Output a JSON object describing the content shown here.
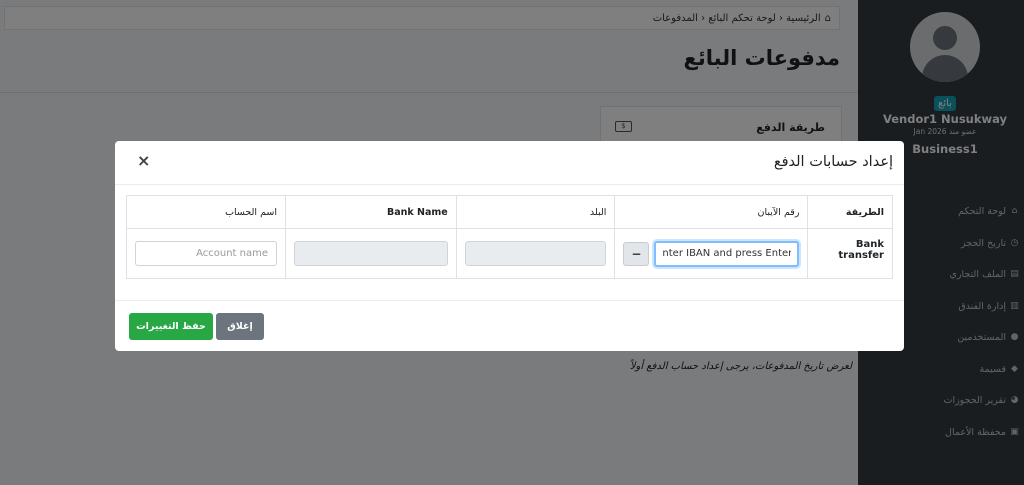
{
  "sidebar": {
    "role_badge": "بائع",
    "vendor_name": "Vendor1 Nusukway",
    "member_since": "عضو منذ Jan 2026",
    "business_name": "Business1",
    "items": [
      {
        "label": "لوحة التحكم",
        "icon": "home-icon",
        "glyph": "⌂"
      },
      {
        "label": "تاريخ الحجز",
        "icon": "clock-icon",
        "glyph": "◷"
      },
      {
        "label": "الملف التجاري",
        "icon": "briefcase-icon",
        "glyph": "▤"
      },
      {
        "label": "إدارة الفندق",
        "icon": "building-icon",
        "glyph": "▥"
      },
      {
        "label": "المستخدمين",
        "icon": "users-icon",
        "glyph": "●"
      },
      {
        "label": "قسيمة",
        "icon": "tag-icon",
        "glyph": "◆"
      },
      {
        "label": "تقرير الحجوزات",
        "icon": "chart-pie-icon",
        "glyph": "◕"
      },
      {
        "label": "محفظة الأعمال",
        "icon": "wallet-icon",
        "glyph": "▣"
      }
    ]
  },
  "breadcrumb": "الرئيسية ‹ لوحة تحكم البائع ‹ المدفوعات",
  "page_title": "مدفوعات البائع",
  "payment_method_card": {
    "title": "طريقة الدفع"
  },
  "notice": "لعرض تاريخ المدفوعات، يرجى إعداد حساب الدفع أولاً",
  "modal": {
    "title": "إعداد حسابات الدفع",
    "close_symbol": "×",
    "table": {
      "headers": {
        "method": "الطريقة",
        "iban": "رقم الآيبان",
        "country": "البلد",
        "bank_name": "Bank Name",
        "account_name": "اسم الحساب"
      },
      "row": {
        "method": "Bank transfer",
        "iban_value": "nter IBAN and press Enter",
        "minus_symbol": "−",
        "account_name_placeholder": "Account name"
      }
    },
    "buttons": {
      "save": "حفظ التغييرات",
      "close": "إغلاق"
    }
  },
  "colors": {
    "sidebar_bg": "#343a40",
    "save_green": "#28a745",
    "close_gray": "#6c757d",
    "badge_teal": "#17a2b8"
  }
}
